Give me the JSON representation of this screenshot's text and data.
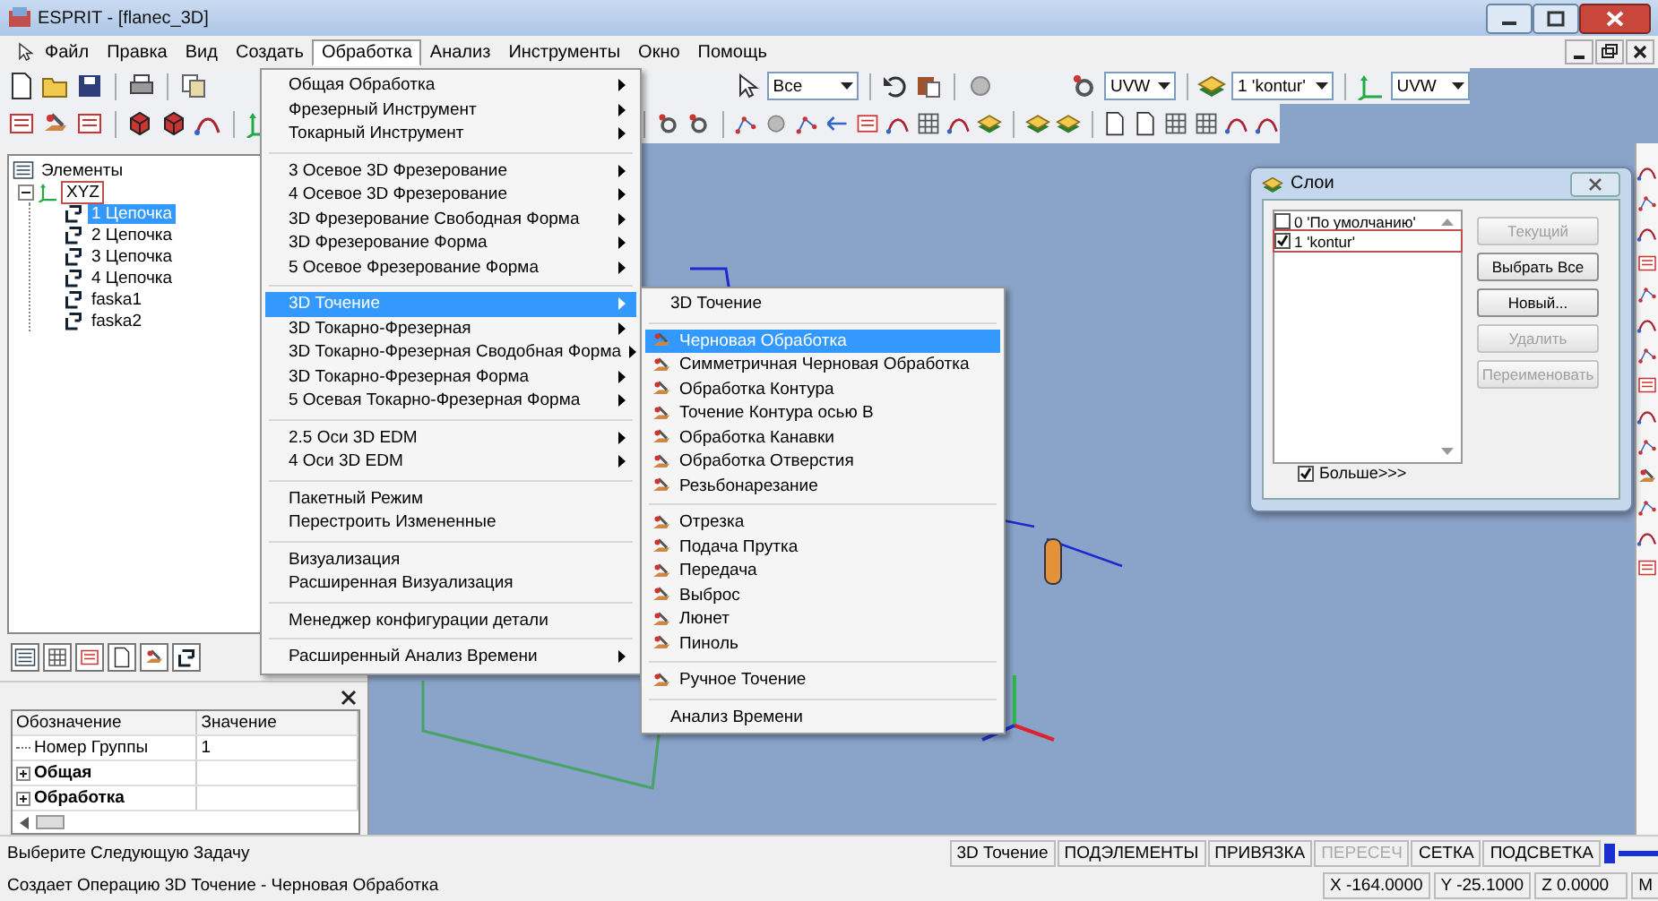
{
  "window": {
    "title": "ESPRIT - [flanec_3D]"
  },
  "menubar": [
    {
      "label": "Файл",
      "selected": false
    },
    {
      "label": "Правка",
      "selected": false
    },
    {
      "label": "Вид",
      "selected": false
    },
    {
      "label": "Создать",
      "selected": false
    },
    {
      "label": "Обработка",
      "selected": true
    },
    {
      "label": "Анализ",
      "selected": false
    },
    {
      "label": "Инструменты",
      "selected": false
    },
    {
      "label": "Окно",
      "selected": false
    },
    {
      "label": "Помощь",
      "selected": false
    }
  ],
  "toolbar": {
    "combos": [
      {
        "value": "Все"
      },
      {
        "value": "UVW"
      },
      {
        "value": "1 'kontur'"
      },
      {
        "value": "UVW"
      }
    ]
  },
  "tree": {
    "label": "Элементы",
    "children": [
      {
        "label": "XYZ",
        "outlined": true,
        "selected": false,
        "children": [
          {
            "label": "1 Цепочка",
            "selected": true
          },
          {
            "label": "2 Цепочка",
            "selected": false
          },
          {
            "label": "3 Цепочка",
            "selected": false
          },
          {
            "label": "4 Цепочка",
            "selected": false
          },
          {
            "label": "faska1",
            "selected": false
          },
          {
            "label": "faska2",
            "selected": false
          }
        ]
      }
    ]
  },
  "properties": {
    "columns": [
      "Обозначение",
      "Значение"
    ],
    "rows": [
      {
        "kind": "leaf",
        "label": "Номер Группы",
        "value": "1"
      },
      {
        "kind": "group",
        "label": "Общая",
        "expanded": false
      },
      {
        "kind": "group",
        "label": "Обработка",
        "expanded": false
      }
    ]
  },
  "menu": {
    "groups": [
      [
        {
          "label": "Общая Обработка",
          "submenu": true,
          "selected": false
        },
        {
          "label": "Фрезерный Инструмент",
          "submenu": true,
          "selected": false
        },
        {
          "label": "Токарный Инструмент",
          "submenu": true,
          "selected": false
        }
      ],
      [
        {
          "label": "3 Осевое 3D Фрезерование",
          "submenu": true,
          "selected": false
        },
        {
          "label": "4 Осевое 3D Фрезерование",
          "submenu": true,
          "selected": false
        },
        {
          "label": "3D Фрезерование Свободная Форма",
          "submenu": true,
          "selected": false
        },
        {
          "label": "3D Фрезерование Форма",
          "submenu": true,
          "selected": false
        },
        {
          "label": "5 Осевое Фрезерование Форма",
          "submenu": true,
          "selected": false
        }
      ],
      [
        {
          "label": "3D Точение",
          "submenu": true,
          "selected": true
        },
        {
          "label": "3D Токарно-Фрезерная",
          "submenu": true,
          "selected": false
        },
        {
          "label": "3D Токарно-Фрезерная Сводобная Форма",
          "submenu": true,
          "selected": false
        },
        {
          "label": "3D Токарно-Фрезерная Форма",
          "submenu": true,
          "selected": false
        },
        {
          "label": "5 Осевая  Токарно-Фрезерная Форма",
          "submenu": true,
          "selected": false
        }
      ],
      [
        {
          "label": "2.5 Оси 3D EDM",
          "submenu": true,
          "selected": false
        },
        {
          "label": "4 Оси 3D EDM",
          "submenu": true,
          "selected": false
        }
      ],
      [
        {
          "label": "Пакетный Режим",
          "submenu": false,
          "selected": false
        },
        {
          "label": "Перестроить Измененные",
          "submenu": false,
          "selected": false
        }
      ],
      [
        {
          "label": "Визуализация",
          "submenu": false,
          "selected": false
        },
        {
          "label": "Расширенная Визуализация",
          "submenu": false,
          "selected": false
        }
      ],
      [
        {
          "label": "Менеджер конфигурации детали",
          "submenu": false,
          "selected": false
        }
      ],
      [
        {
          "label": "Расширенный Анализ Времени",
          "submenu": true,
          "selected": false
        }
      ]
    ]
  },
  "submenu": {
    "groups": [
      [
        {
          "label": "3D Точение",
          "kind": "plain",
          "selected": false
        }
      ],
      [
        {
          "label": "Черновая Обработка",
          "kind": "icon",
          "selected": true
        },
        {
          "label": "Симметричная Черновая Обработка",
          "kind": "icon",
          "selected": false
        },
        {
          "label": "Обработка Контура",
          "kind": "icon",
          "selected": false
        },
        {
          "label": "Точение Контура осью B",
          "kind": "icon",
          "selected": false
        },
        {
          "label": "Обработка Канавки",
          "kind": "icon",
          "selected": false
        },
        {
          "label": "Обработка Отверстия",
          "kind": "icon",
          "selected": false
        },
        {
          "label": "Резьбонарезание",
          "kind": "icon",
          "selected": false
        }
      ],
      [
        {
          "label": "Отрезка",
          "kind": "icon",
          "selected": false
        },
        {
          "label": "Подача Прутка",
          "kind": "icon",
          "selected": false
        },
        {
          "label": "Передача",
          "kind": "icon",
          "selected": false
        },
        {
          "label": "Выброс",
          "kind": "icon",
          "selected": false
        },
        {
          "label": "Люнет",
          "kind": "icon",
          "selected": false
        },
        {
          "label": "Пиноль",
          "kind": "icon",
          "selected": false
        }
      ],
      [
        {
          "label": "Ручное Точение",
          "kind": "icon",
          "selected": false
        }
      ],
      [
        {
          "label": "Анализ Времени",
          "kind": "plain",
          "selected": false
        }
      ]
    ]
  },
  "layers_dialog": {
    "title": "Слои",
    "layers": [
      {
        "label": "0 'По умолчанию'",
        "checked": false,
        "selected": false
      },
      {
        "label": "1 'kontur'",
        "checked": true,
        "selected": true
      }
    ],
    "buttons": [
      {
        "label": "Текущий",
        "disabled": true
      },
      {
        "label": "Выбрать Все",
        "disabled": false
      },
      {
        "label": "Новый...",
        "disabled": false
      },
      {
        "label": "Удалить",
        "disabled": true
      },
      {
        "label": "Переименовать",
        "disabled": true
      }
    ],
    "more": {
      "label": "Больше>>>",
      "checked": true
    }
  },
  "status_bar": {
    "message": "Выберите Следующую Задачу",
    "panes": [
      {
        "label": "3D Точение",
        "disabled": false
      },
      {
        "label": "ПОДЭЛЕМЕНТЫ",
        "disabled": false
      },
      {
        "label": "ПРИВЯЗКА",
        "disabled": false
      },
      {
        "label": "ПЕРЕСЕЧ",
        "disabled": true
      },
      {
        "label": "СЕТКА",
        "disabled": false
      },
      {
        "label": "ПОДСВЕТКА",
        "disabled": false
      }
    ],
    "hint": "Создает Операцию 3D Точение - Черновая Обработка",
    "coords": [
      "X -164.0000",
      "Y -25.1000",
      "Z 0.0000",
      "M"
    ]
  }
}
